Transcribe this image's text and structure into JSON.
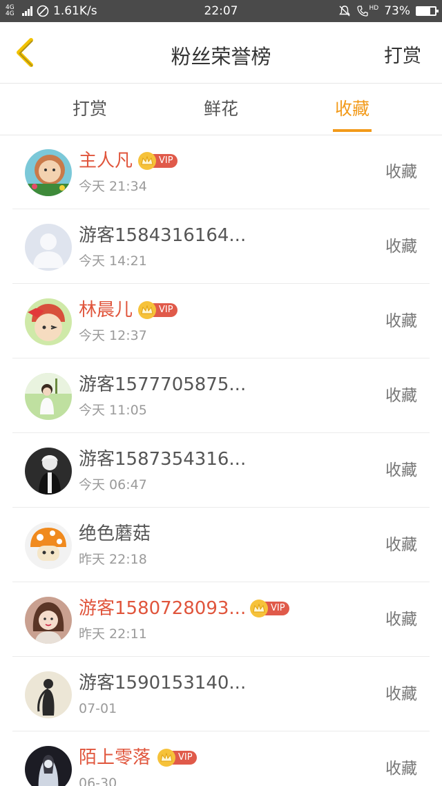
{
  "status_bar": {
    "net_type_top": "4G",
    "net_type_bottom": "4G",
    "speed": "1.61K/s",
    "time": "22:07",
    "call_label": "HD",
    "battery": "73%",
    "battery_level": 0.73
  },
  "header": {
    "title": "粉丝荣誉榜",
    "right_action": "打赏",
    "back_icon": "chevron-left-icon",
    "accent_color": "#f29a1a"
  },
  "tabs": [
    {
      "label": "打赏",
      "active": false
    },
    {
      "label": "鲜花",
      "active": false
    },
    {
      "label": "收藏",
      "active": true
    }
  ],
  "fans": [
    {
      "name": "主人凡",
      "time": "今天 21:34",
      "action": "收藏",
      "vip": true,
      "vip_label": "VIP",
      "avatar": "cartoon-girl-avatar"
    },
    {
      "name": "游客1584316164...",
      "time": "今天 14:21",
      "action": "收藏",
      "vip": false,
      "avatar": "default-avatar"
    },
    {
      "name": "林晨儿",
      "time": "今天 12:37",
      "action": "收藏",
      "vip": true,
      "vip_label": "VIP",
      "avatar": "bow-character-avatar"
    },
    {
      "name": "游客1577705875...",
      "time": "今天 11:05",
      "action": "收藏",
      "vip": false,
      "avatar": "woman-outdoor-avatar"
    },
    {
      "name": "游客1587354316...",
      "time": "今天 06:47",
      "action": "收藏",
      "vip": false,
      "avatar": "dark-anime-avatar"
    },
    {
      "name": "绝色蘑菇",
      "time": "昨天 22:18",
      "action": "收藏",
      "vip": false,
      "avatar": "mushroom-avatar"
    },
    {
      "name": "游客1580728093...",
      "time": "昨天 22:11",
      "action": "收藏",
      "vip": true,
      "vip_label": "VIP",
      "avatar": "girl-portrait-avatar"
    },
    {
      "name": "游客1590153140...",
      "time": "07-01",
      "action": "收藏",
      "vip": false,
      "avatar": "silhouette-avatar"
    },
    {
      "name": "陌上零落",
      "time": "06-30",
      "action": "收藏",
      "vip": true,
      "vip_label": "VIP",
      "avatar": "ghostly-figure-avatar"
    }
  ]
}
